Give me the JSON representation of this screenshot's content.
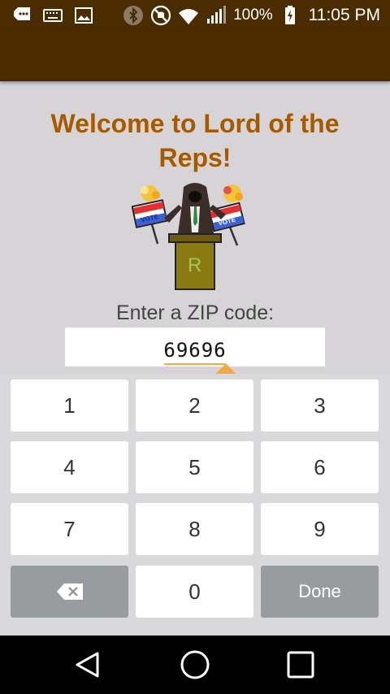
{
  "status_bar": {
    "icons_left": [
      "message-icon",
      "keyboard-icon",
      "image-icon"
    ],
    "icons_right": [
      "bluetooth-icon",
      "do-not-disturb-icon",
      "wifi-icon",
      "signal-icon",
      "battery-charging-icon"
    ],
    "battery_percent": "100%",
    "time": "11:05 PM"
  },
  "header": {
    "title": "Welcome to Lord of the Reps!"
  },
  "logo": {
    "sign_left": "VOTE",
    "sign_right": "VOTE",
    "podium_letter": "R"
  },
  "zip": {
    "label": "Enter a ZIP code:",
    "value": "69696"
  },
  "keypad": {
    "keys": [
      "1",
      "2",
      "3",
      "4",
      "5",
      "6",
      "7",
      "8",
      "9",
      "0"
    ],
    "backspace_icon": "backspace-icon",
    "done_label": "Done"
  },
  "nav": {
    "icons": [
      "back-icon",
      "home-icon",
      "recents-icon"
    ]
  },
  "colors": {
    "app_bar": "#4b2c00",
    "title": "#a65a00",
    "background": "#d6d4d6",
    "cursor": "#f5a742",
    "dark_key": "#999c9e"
  }
}
